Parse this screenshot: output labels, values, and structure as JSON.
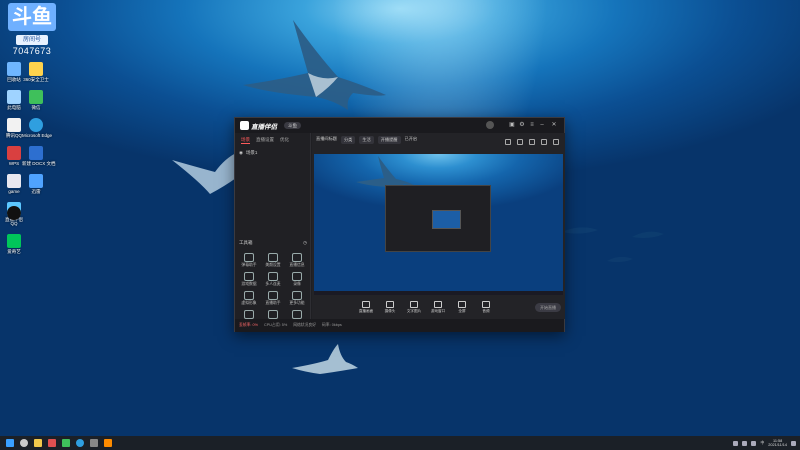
{
  "overlay": {
    "logo_text": "斗鱼",
    "tag": "房间号",
    "room_number": "7047673"
  },
  "desktop_icons": [
    {
      "label": "回收站",
      "color": "#6fb6ff"
    },
    {
      "label": "此电脑",
      "color": "#9fd3ff"
    },
    {
      "label": "360安全卫士",
      "color": "#ffd34d"
    },
    {
      "label": "腾讯QQ",
      "color": "#f2f2f2"
    },
    {
      "label": "微信",
      "color": "#3fc05b"
    },
    {
      "label": "WPS",
      "color": "#d94040"
    },
    {
      "label": "Microsoft Edge",
      "color": "#2f9fe0"
    },
    {
      "label": "game",
      "color": "#e8e8f0"
    },
    {
      "label": "新建 DOCX 文档",
      "color": "#2d6fd0"
    },
    {
      "label": "直播伴侣",
      "color": "#5cc7ff"
    },
    {
      "label": "迅雷",
      "color": "#4fa3ff"
    },
    {
      "label": "QQ",
      "color": "#111111"
    },
    {
      "label": "爱奇艺",
      "color": "#00c65a"
    }
  ],
  "app": {
    "name": "直播伴侣",
    "title_chip": "斗鱼",
    "left_tabs": [
      "场景",
      "直播设置",
      "优化"
    ],
    "scene_item": "场景1",
    "tools_title": "工具箱",
    "tools": [
      {
        "label": "弹幕助手"
      },
      {
        "label": "美颜设置"
      },
      {
        "label": "直播信息"
      },
      {
        "label": "游戏数据"
      },
      {
        "label": "多人连麦"
      },
      {
        "label": "录像"
      },
      {
        "label": "虚拟形象"
      },
      {
        "label": "直播助手"
      },
      {
        "label": "更多功能"
      },
      {
        "label": "点歌"
      },
      {
        "label": "投票"
      },
      {
        "label": "分享"
      }
    ],
    "main_top": {
      "room_title_label": "直播间标题",
      "category_label": "分类",
      "category_value": "生活",
      "notice_label": "开播提醒",
      "notice_value": "已开启"
    },
    "bottom_tools": [
      {
        "label": "直播画面"
      },
      {
        "label": "摄像头"
      },
      {
        "label": "文字图片"
      },
      {
        "label": "游戏窗口"
      },
      {
        "label": "全屏"
      },
      {
        "label": "音频"
      }
    ],
    "go_live_label": "开始直播",
    "status_items": [
      "丢帧率: 0%",
      "CPU占用: 5%",
      "网络状况良好",
      "码率: 0kbps"
    ]
  },
  "taskbar": {
    "time": "11:58",
    "date": "2021/11/14",
    "ime": "中"
  }
}
